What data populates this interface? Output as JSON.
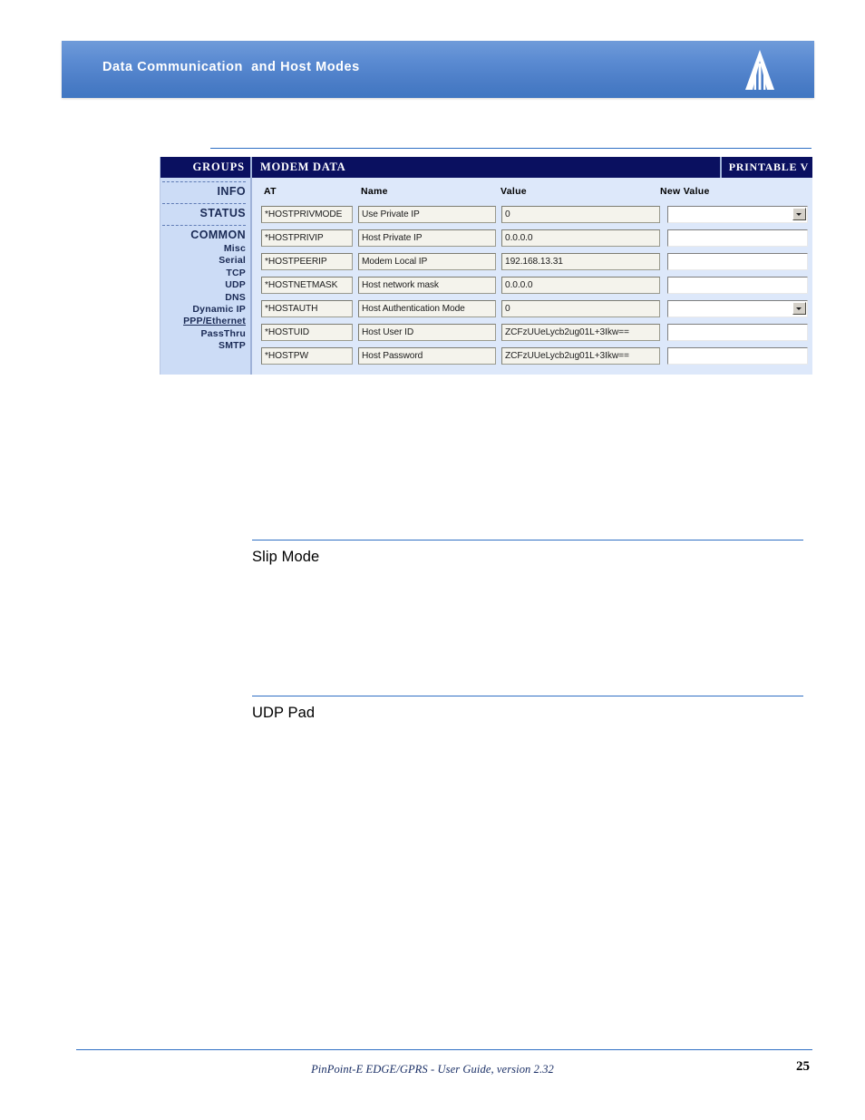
{
  "banner": {
    "title": "Data Communication  and Host Modes",
    "logo_icon": "sierra-wireless-logo-icon",
    "gradient_top": "#6f9bd9",
    "gradient_bottom": "#4077c2"
  },
  "app_screenshot": {
    "topbar": {
      "groups_label": "GROUPS",
      "section_label": "MODEM DATA",
      "printable_label": "PRINTABLE V",
      "background": "#0a1060"
    },
    "sidebar": {
      "items": [
        {
          "label": "INFO",
          "type": "major",
          "active": false,
          "separator_above": true
        },
        {
          "label": "STATUS",
          "type": "major",
          "active": false,
          "separator_above": true
        },
        {
          "label": "COMMON",
          "type": "major",
          "active": false,
          "separator_above": true
        },
        {
          "label": "Misc",
          "type": "minor",
          "active": false,
          "separator_above": false
        },
        {
          "label": "Serial",
          "type": "minor",
          "active": false,
          "separator_above": false
        },
        {
          "label": "TCP",
          "type": "minor",
          "active": false,
          "separator_above": false
        },
        {
          "label": "UDP",
          "type": "minor",
          "active": false,
          "separator_above": false
        },
        {
          "label": "DNS",
          "type": "minor",
          "active": false,
          "separator_above": false
        },
        {
          "label": "Dynamic IP",
          "type": "minor",
          "active": false,
          "separator_above": false
        },
        {
          "label": "PPP/Ethernet",
          "type": "minor",
          "active": true,
          "separator_above": false
        },
        {
          "label": "PassThru",
          "type": "minor",
          "active": false,
          "separator_above": false
        },
        {
          "label": "SMTP",
          "type": "minor",
          "active": false,
          "separator_above": false
        }
      ],
      "background": "#ccdcf6"
    },
    "table": {
      "columns": [
        "AT",
        "Name",
        "Value",
        "New Value"
      ],
      "rows": [
        {
          "at": "*HOSTPRIVMODE",
          "name": "Use Private IP",
          "value": "0",
          "new_value": "",
          "new_control": "select"
        },
        {
          "at": "*HOSTPRIVIP",
          "name": "Host Private IP",
          "value": "0.0.0.0",
          "new_value": "",
          "new_control": "text"
        },
        {
          "at": "*HOSTPEERIP",
          "name": "Modem Local IP",
          "value": "192.168.13.31",
          "new_value": "",
          "new_control": "text"
        },
        {
          "at": "*HOSTNETMASK",
          "name": "Host network mask",
          "value": "0.0.0.0",
          "new_value": "",
          "new_control": "text"
        },
        {
          "at": "*HOSTAUTH",
          "name": "Host Authentication Mode",
          "value": "0",
          "new_value": "",
          "new_control": "select"
        },
        {
          "at": "*HOSTUID",
          "name": "Host User ID",
          "value": "ZCFzUUeLycb2ug01L+3Ikw==",
          "new_value": "",
          "new_control": "text"
        },
        {
          "at": "*HOSTPW",
          "name": "Host Password",
          "value": "ZCFzUUeLycb2ug01L+3Ikw==",
          "new_value": "",
          "new_control": "text"
        }
      ],
      "background": "#dde8fa"
    }
  },
  "sections": [
    {
      "title": "Slip Mode"
    },
    {
      "title": "UDP Pad"
    }
  ],
  "footer": {
    "document": "PinPoint-E EDGE/GPRS - User Guide, version 2.32",
    "page_number": "25",
    "rule_color": "#2f6fc4"
  }
}
